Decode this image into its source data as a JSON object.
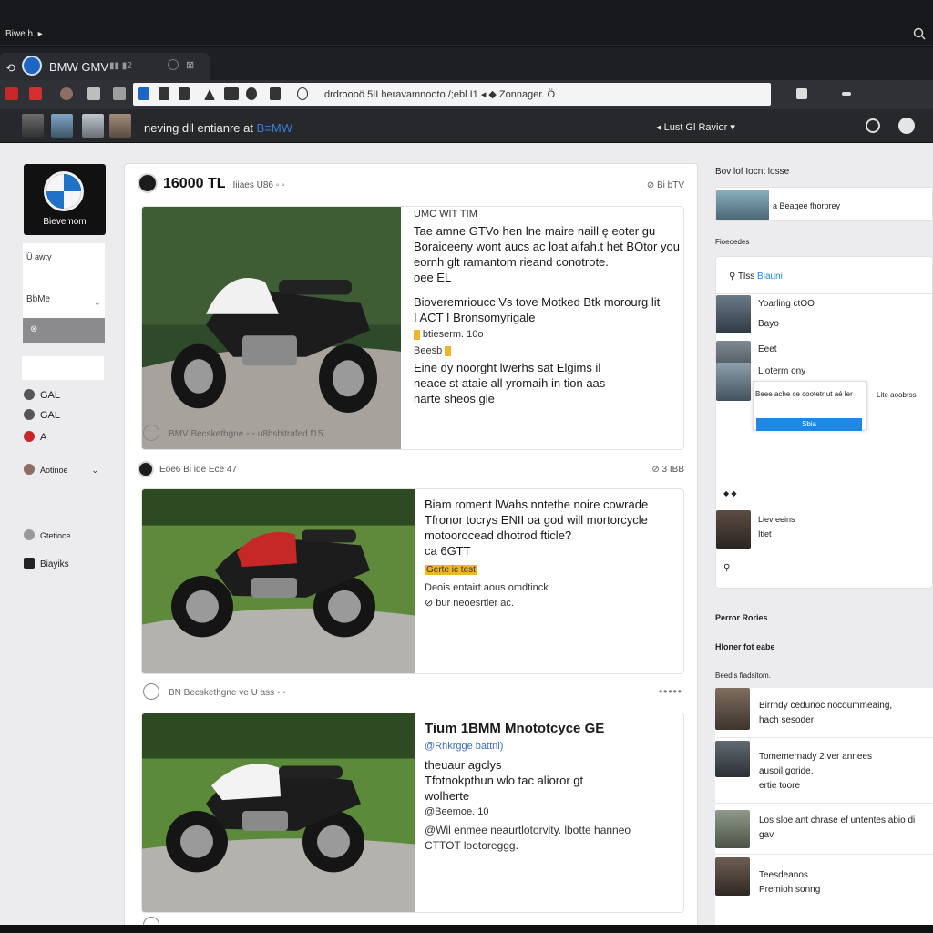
{
  "os": {
    "label": "Biwe h. ▸"
  },
  "browser": {
    "tab_title": "BMW GMV",
    "tab_extra": "▮▮ ▮2",
    "url_text": "drdroooö 5II heravamnooto /;ebl I1 ◂  ◆ Zonnager. Ö",
    "page_heading": "neving dil entianre at",
    "page_heading_link": "B≡MW",
    "right_link": "◂ Lust Gl Ravior ▾"
  },
  "sidebar": {
    "brand_name": "Bievemom",
    "card_label_a": "Ü awty",
    "card_label_b": "BbMe",
    "gray_label": "⊗",
    "nav": [
      {
        "label": "GAL"
      },
      {
        "label": "GAL"
      },
      {
        "label": "A"
      },
      {
        "label": "Aotinoe"
      }
    ],
    "nav_bottom": [
      {
        "label": "Gtetioce"
      },
      {
        "label": "Biayiks"
      }
    ]
  },
  "feed": {
    "post1": {
      "title": "16000 TL",
      "meta_small": "Iiiaes U86 ◦ ◦",
      "meta_right": "⊘ Bi bTV",
      "caption_head": "UMC WIT TIM",
      "lines": [
        "Tae amne GTVo hen lne maire naill ę eoter gu",
        "Boraiceeny wont aucs ac loat aifah.t het BOtor you",
        "eornh glt ramantom rieand conotrote.",
        "oee EL"
      ],
      "lines2": [
        "Bioveremrioucc Vs tove Motked Btk morourg lit",
        "I ACT I Bronsomyrigale"
      ],
      "tag_line": "btieserm. 10o",
      "tag_line2": "Beesb",
      "lines3": [
        "Eine dy noorght lwerhs sat Elgims il",
        "neace st ataie all yromaih in tion aas",
        "narte sheos gle"
      ],
      "footer": "BMV Becskethgne ◦ ◦ u8hshitrafed f15"
    },
    "post2": {
      "meta_small": "Eoe6 Bi ide Ece 47",
      "meta_right": "⊘ 3 ІВB",
      "lines": [
        "Biam roment lWahs nntethe noire cowrade",
        "Tfronor tocrys ENII oa god will mortorcycle",
        "motoorocead dhotrod fticle?",
        "ca 6GTT"
      ],
      "tag_line": "Gerte ic test",
      "lines2": [
        "Deois entairt aous omdtinck",
        "⊘ bur neoesrtier ac."
      ],
      "footer": "BN Becskethgne ve U ass ◦ ◦",
      "dots": "•••••"
    },
    "post3": {
      "title": "Tium 1BMM Mnototcyce GE",
      "subtitle": "@Rhkrgge battni)",
      "lines": [
        "theuaur agclys",
        "Tfotnokpthun wlo tac alioror gt",
        "wolherte"
      ],
      "tag_line": "@Beemoe. 10",
      "lines2": [
        "@Wil enmee neaurtlotorvity. lbotte hanneo",
        "CTTOT lootoreggg."
      ]
    }
  },
  "right": {
    "section1_title": "Bov lof Iocnt losse",
    "item1": "a Beagee fhorprey",
    "section2_title": "Fioeoedes",
    "box_title_prefix": "Tlss",
    "box_title_link": "Biauni",
    "items": [
      {
        "label": "Yoarling ctOO"
      },
      {
        "label": "Bayo"
      },
      {
        "label": "Eeet"
      },
      {
        "label": "Lioterm ony"
      }
    ],
    "popover_text": "Beee ache ce cootetr ut aé ler",
    "popover_side": "Lite aoabrss",
    "button_label": "Sbia",
    "bullets": "◆ ◆",
    "live_title": "Liev eeins",
    "live_sub": "Itiet",
    "popular_title": "Perror Rories",
    "related_title": "Hloner fot eabe",
    "related_sub": "Beedis fiadsitom.",
    "related": [
      {
        "line1": "Birrndy cedunoc nocoummeaing,",
        "line2": "hach sesoder"
      },
      {
        "line1": "Tomemernady 2 ver annees",
        "line2": "ausoil goride,",
        "line3": "ertie toore"
      },
      {
        "line1": "Los sloe ant chrase ef untentes abio di",
        "line2": "gav"
      },
      {
        "line1": "Teesdeanos",
        "line2": "Premioh sonng"
      }
    ]
  }
}
